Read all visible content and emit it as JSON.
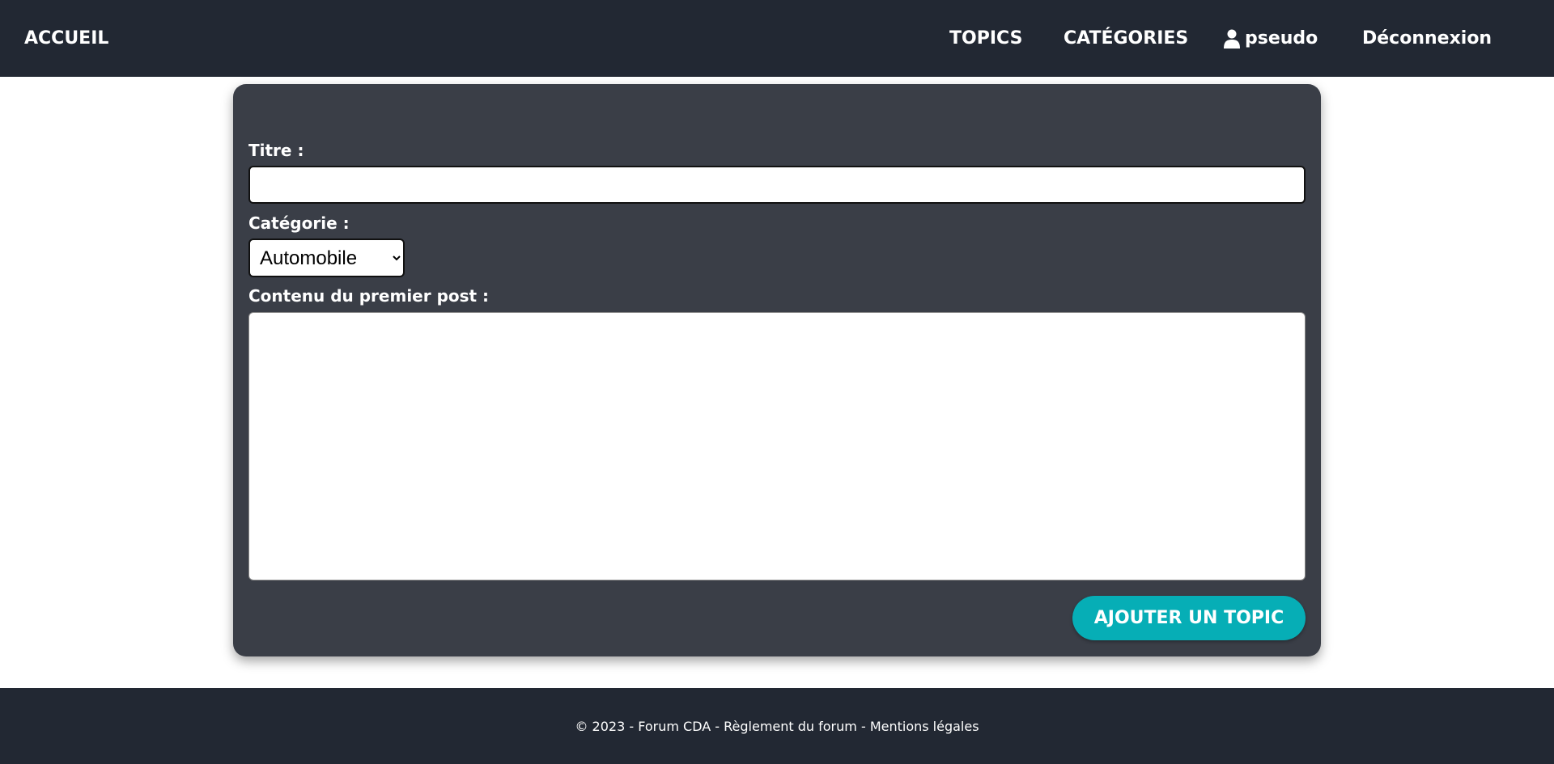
{
  "nav": {
    "home": "ACCUEIL",
    "topics": "TOPICS",
    "categories": "CATÉGORIES",
    "user": "pseudo",
    "logout": "Déconnexion"
  },
  "form": {
    "heading": "AJOUTER UN TOPIC",
    "title_label": "Titre :",
    "title_value": "",
    "category_label": "Catégorie :",
    "category_selected": "Automobile",
    "content_label": "Contenu du premier post :",
    "content_value": "",
    "submit_label": "AJOUTER UN TOPIC"
  },
  "footer": {
    "copyright": "© 2023 - Forum CDA",
    "separator": " - ",
    "rules": "Règlement du forum",
    "legal": "Mentions légales"
  },
  "colors": {
    "navbar_bg": "#222833",
    "card_bg": "#3a3e47",
    "accent": "#06aeb6"
  },
  "icons": {
    "user": "user-icon"
  }
}
